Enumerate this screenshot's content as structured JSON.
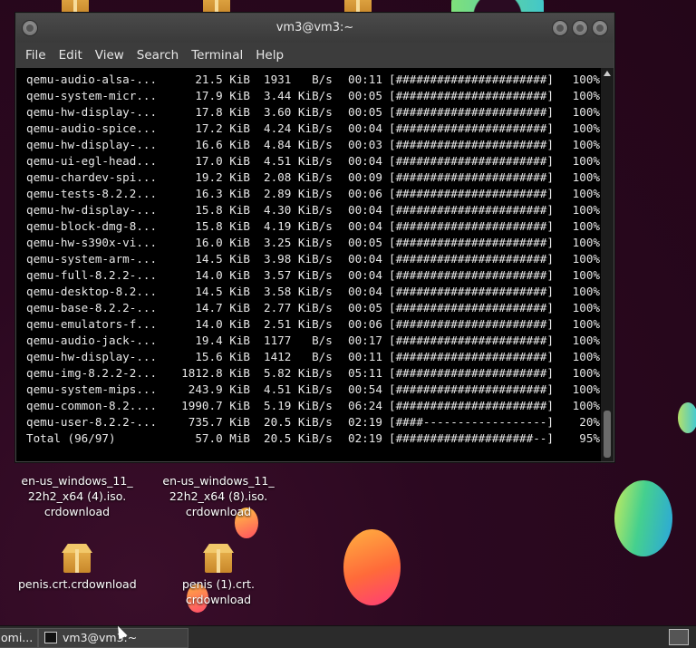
{
  "window": {
    "title": "vm3@vm3:~",
    "menu": [
      "File",
      "Edit",
      "View",
      "Search",
      "Terminal",
      "Help"
    ]
  },
  "terminal": {
    "rows": [
      {
        "name": "qemu-audio-alsa-...",
        "size": "21.5 KiB",
        "speed": "1931   B/s",
        "eta": "00:11",
        "bar": "[######################]",
        "pct": "100%"
      },
      {
        "name": "qemu-system-micr...",
        "size": "17.9 KiB",
        "speed": "3.44 KiB/s",
        "eta": "00:05",
        "bar": "[######################]",
        "pct": "100%"
      },
      {
        "name": "qemu-hw-display-...",
        "size": "17.8 KiB",
        "speed": "3.60 KiB/s",
        "eta": "00:05",
        "bar": "[######################]",
        "pct": "100%"
      },
      {
        "name": "qemu-audio-spice...",
        "size": "17.2 KiB",
        "speed": "4.24 KiB/s",
        "eta": "00:04",
        "bar": "[######################]",
        "pct": "100%"
      },
      {
        "name": "qemu-hw-display-...",
        "size": "16.6 KiB",
        "speed": "4.84 KiB/s",
        "eta": "00:03",
        "bar": "[######################]",
        "pct": "100%"
      },
      {
        "name": "qemu-ui-egl-head...",
        "size": "17.0 KiB",
        "speed": "4.51 KiB/s",
        "eta": "00:04",
        "bar": "[######################]",
        "pct": "100%"
      },
      {
        "name": "qemu-chardev-spi...",
        "size": "19.2 KiB",
        "speed": "2.08 KiB/s",
        "eta": "00:09",
        "bar": "[######################]",
        "pct": "100%"
      },
      {
        "name": "qemu-tests-8.2.2...",
        "size": "16.3 KiB",
        "speed": "2.89 KiB/s",
        "eta": "00:06",
        "bar": "[######################]",
        "pct": "100%"
      },
      {
        "name": "qemu-hw-display-...",
        "size": "15.8 KiB",
        "speed": "4.30 KiB/s",
        "eta": "00:04",
        "bar": "[######################]",
        "pct": "100%"
      },
      {
        "name": "qemu-block-dmg-8...",
        "size": "15.8 KiB",
        "speed": "4.19 KiB/s",
        "eta": "00:04",
        "bar": "[######################]",
        "pct": "100%"
      },
      {
        "name": "qemu-hw-s390x-vi...",
        "size": "16.0 KiB",
        "speed": "3.25 KiB/s",
        "eta": "00:05",
        "bar": "[######################]",
        "pct": "100%"
      },
      {
        "name": "qemu-system-arm-...",
        "size": "14.5 KiB",
        "speed": "3.98 KiB/s",
        "eta": "00:04",
        "bar": "[######################]",
        "pct": "100%"
      },
      {
        "name": "qemu-full-8.2.2-...",
        "size": "14.0 KiB",
        "speed": "3.57 KiB/s",
        "eta": "00:04",
        "bar": "[######################]",
        "pct": "100%"
      },
      {
        "name": "qemu-desktop-8.2...",
        "size": "14.5 KiB",
        "speed": "3.58 KiB/s",
        "eta": "00:04",
        "bar": "[######################]",
        "pct": "100%"
      },
      {
        "name": "qemu-base-8.2.2-...",
        "size": "14.7 KiB",
        "speed": "2.77 KiB/s",
        "eta": "00:05",
        "bar": "[######################]",
        "pct": "100%"
      },
      {
        "name": "qemu-emulators-f...",
        "size": "14.0 KiB",
        "speed": "2.51 KiB/s",
        "eta": "00:06",
        "bar": "[######################]",
        "pct": "100%"
      },
      {
        "name": "qemu-audio-jack-...",
        "size": "19.4 KiB",
        "speed": "1177   B/s",
        "eta": "00:17",
        "bar": "[######################]",
        "pct": "100%"
      },
      {
        "name": "qemu-hw-display-...",
        "size": "15.6 KiB",
        "speed": "1412   B/s",
        "eta": "00:11",
        "bar": "[######################]",
        "pct": "100%"
      },
      {
        "name": "qemu-img-8.2.2-2...",
        "size": "1812.8 KiB",
        "speed": "5.82 KiB/s",
        "eta": "05:11",
        "bar": "[######################]",
        "pct": "100%"
      },
      {
        "name": "qemu-system-mips...",
        "size": "243.9 KiB",
        "speed": "4.51 KiB/s",
        "eta": "00:54",
        "bar": "[######################]",
        "pct": "100%"
      },
      {
        "name": "qemu-common-8.2....",
        "size": "1990.7 KiB",
        "speed": "5.19 KiB/s",
        "eta": "06:24",
        "bar": "[######################]",
        "pct": "100%"
      },
      {
        "name": "qemu-user-8.2.2-...",
        "size": "735.7 KiB",
        "speed": "20.5 KiB/s",
        "eta": "02:19",
        "bar": "[####------------------]",
        "pct": "20%"
      },
      {
        "name": "Total (96/97)",
        "size": "57.0 MiB",
        "speed": "20.5 KiB/s",
        "eta": "02:19",
        "bar": "[####################--]",
        "pct": "95%"
      }
    ]
  },
  "desktop": {
    "icons": [
      {
        "label": "en-us_windows_11_\n22h2_x64 (4).iso.\ncrdownload"
      },
      {
        "label": "en-us_windows_11_\n22h2_x64 (8).iso.\ncrdownload"
      },
      {
        "label": "penis.crt.crdownload"
      },
      {
        "label": "penis (1).crt.\ncrdownload"
      }
    ]
  },
  "taskbar": {
    "left_task": "omi...",
    "terminal_task": "vm3@vm3:~"
  }
}
